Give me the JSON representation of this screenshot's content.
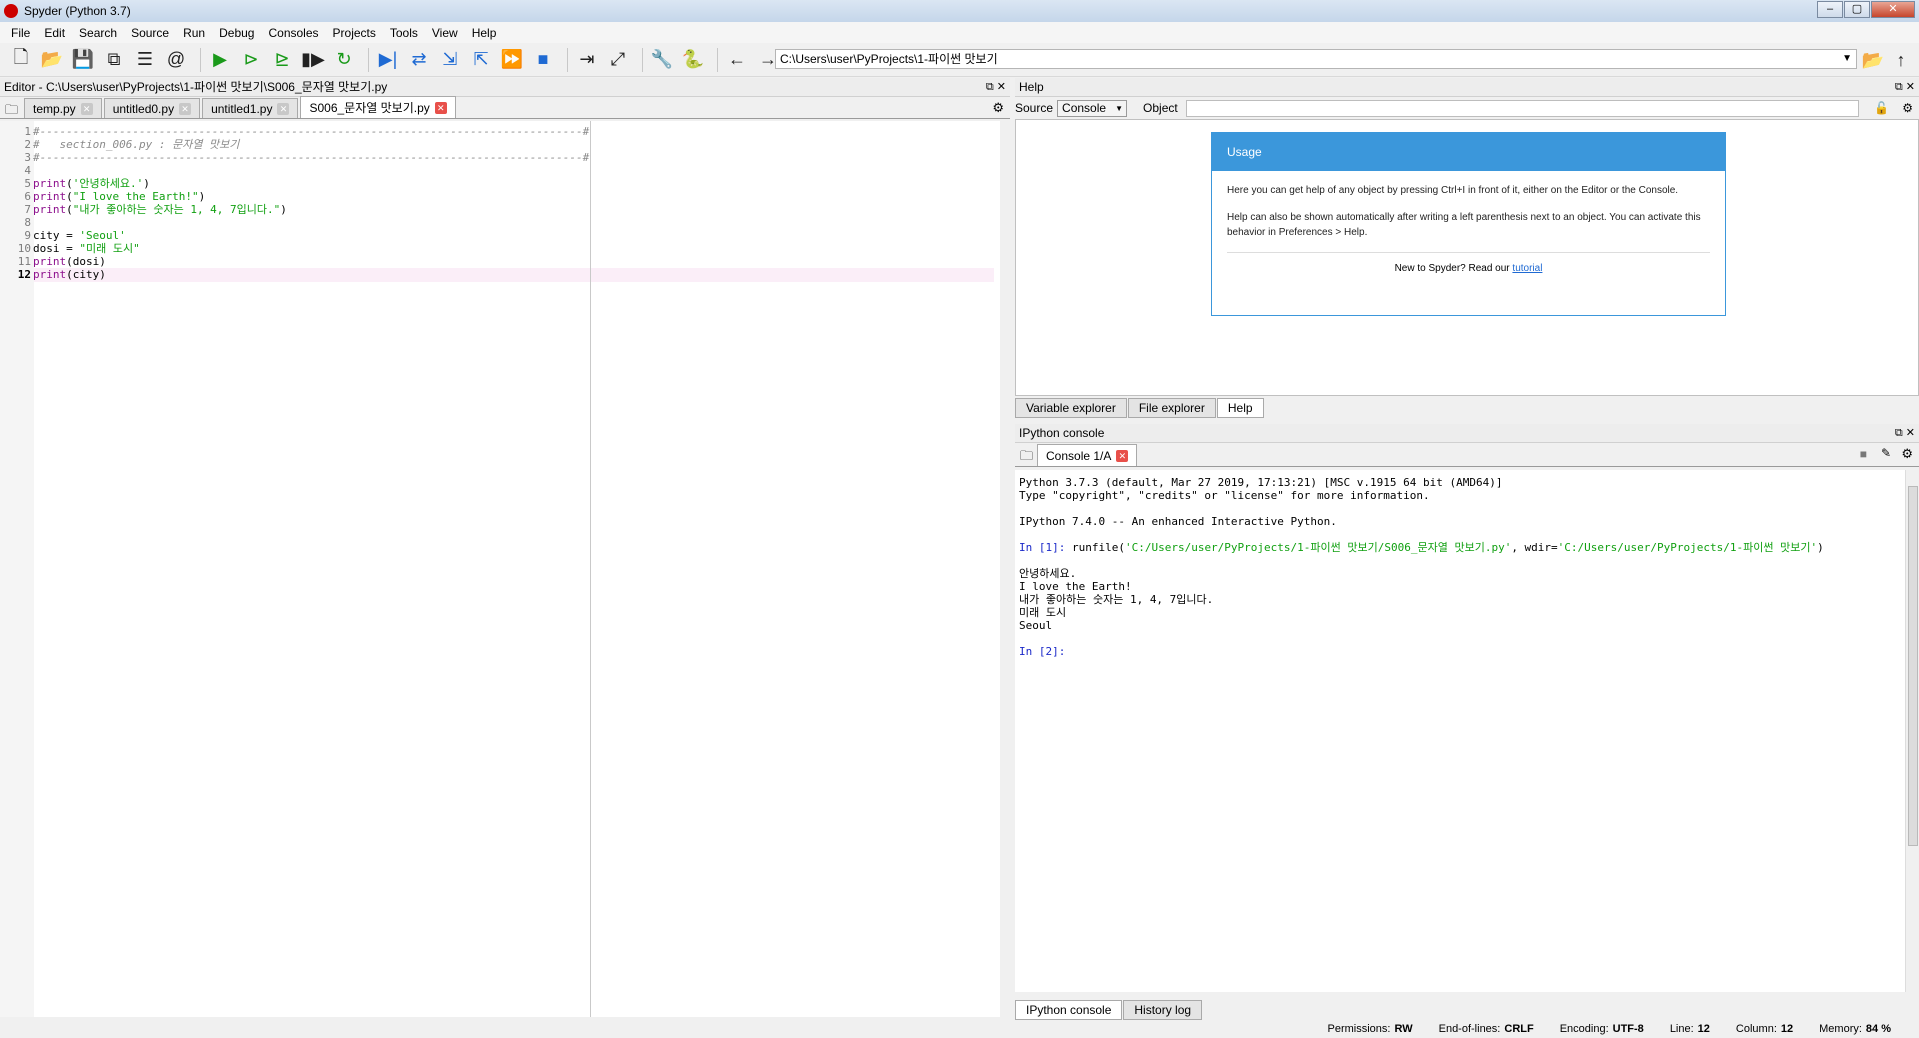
{
  "window": {
    "title": "Spyder (Python 3.7)"
  },
  "menu": [
    "File",
    "Edit",
    "Search",
    "Source",
    "Run",
    "Debug",
    "Consoles",
    "Projects",
    "Tools",
    "View",
    "Help"
  ],
  "path": "C:\\Users\\user\\PyProjects\\1-파이썬 맛보기",
  "editor": {
    "title": "Editor - C:\\Users\\user\\PyProjects\\1-파이썬 맛보기\\S006_문자열 맛보기.py",
    "tabs": [
      "temp.py",
      "untitled0.py",
      "untitled1.py",
      "S006_문자열 맛보기.py"
    ],
    "active_tab": 3,
    "lines": [
      "#----------------------------------------------------------------------------------#",
      "#   section_006.py : 문자열 맛보기",
      "#----------------------------------------------------------------------------------#",
      "",
      "print('안녕하세요.')",
      "print(\"I love the Earth!\")",
      "print(\"내가 좋아하는 숫자는 1, 4, 7입니다.\")",
      "",
      "city = 'Seoul'",
      "dosi = \"미래 도시\"",
      "print(dosi)",
      "print(city)"
    ],
    "current_line": 12
  },
  "help": {
    "title": "Help",
    "source_label": "Source",
    "source_value": "Console",
    "object_label": "Object",
    "usage_title": "Usage",
    "usage_p1": "Here you can get help of any object by pressing Ctrl+I in front of it, either on the Editor or the Console.",
    "usage_p2": "Help can also be shown automatically after writing a left parenthesis next to an object. You can activate this behavior in Preferences > Help.",
    "new_text": "New to Spyder? Read our",
    "tutorial": "tutorial",
    "bottom_tabs": [
      "Variable explorer",
      "File explorer",
      "Help"
    ]
  },
  "console": {
    "title": "IPython console",
    "tab": "Console 1/A",
    "lines": [
      "Python 3.7.3 (default, Mar 27 2019, 17:13:21) [MSC v.1915 64 bit (AMD64)]",
      "Type \"copyright\", \"credits\" or \"license\" for more information.",
      "",
      "IPython 7.4.0 -- An enhanced Interactive Python.",
      "",
      "In [1]: runfile('C:/Users/user/PyProjects/1-파이썬 맛보기/S006_문자열 맛보기.py', wdir='C:/Users/user/PyProjects/1-파이썬 맛보기')",
      "안녕하세요.",
      "I love the Earth!",
      "내가 좋아하는 숫자는 1, 4, 7입니다.",
      "미래 도시",
      "Seoul",
      "",
      "In [2]:"
    ],
    "bottom_tabs": [
      "IPython console",
      "History log"
    ]
  },
  "status": {
    "permissions_label": "Permissions:",
    "permissions": "RW",
    "eol_label": "End-of-lines:",
    "eol": "CRLF",
    "encoding_label": "Encoding:",
    "encoding": "UTF-8",
    "line_label": "Line:",
    "line": "12",
    "column_label": "Column:",
    "column": "12",
    "memory_label": "Memory:",
    "memory": "84 %"
  }
}
